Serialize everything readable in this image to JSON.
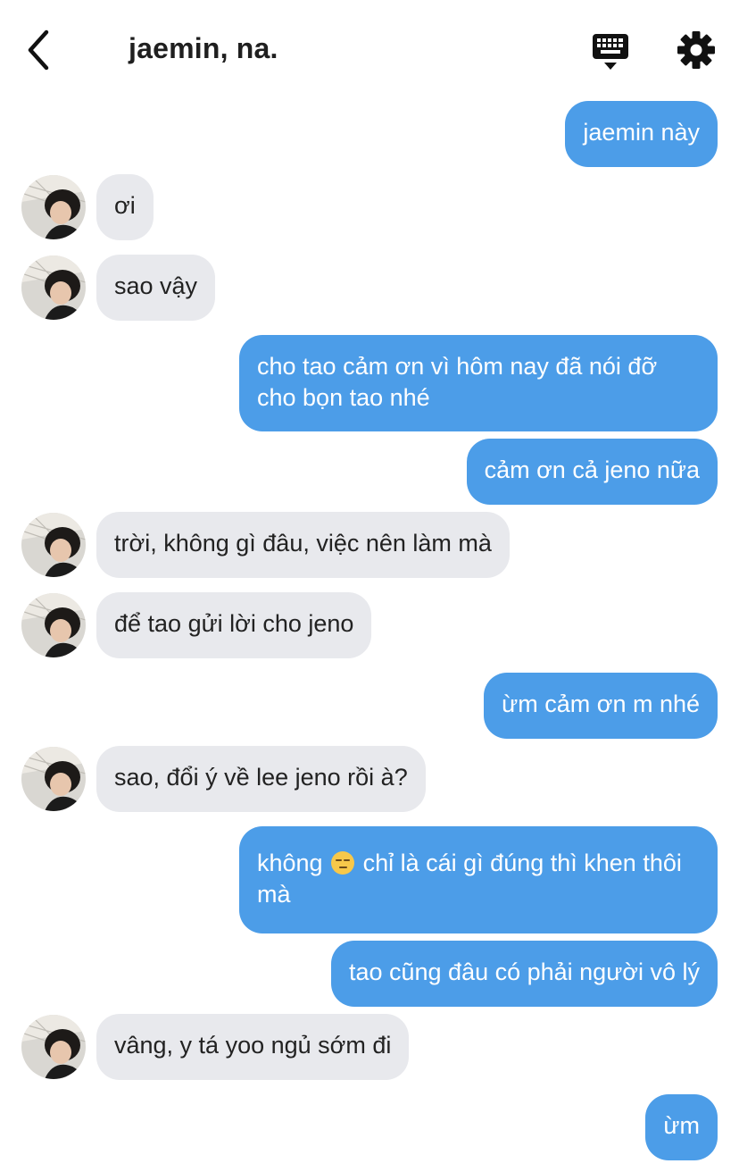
{
  "header": {
    "title": "jaemin, na."
  },
  "icons": {
    "back": "chevron-left-icon",
    "keyboard": "keyboard-icon",
    "settings": "gear-icon"
  },
  "colors": {
    "outgoing_bubble": "#4c9de8",
    "incoming_bubble": "#e8e9ed"
  },
  "messages": [
    {
      "side": "out",
      "text": "jaemin này"
    },
    {
      "side": "in",
      "text": "ơi"
    },
    {
      "side": "in",
      "text": "sao vậy"
    },
    {
      "side": "out",
      "text": "cho tao cảm ơn vì hôm nay đã nói đỡ cho bọn tao nhé"
    },
    {
      "side": "out",
      "text": "cảm ơn cả jeno nữa"
    },
    {
      "side": "in",
      "text": "trời, không gì đâu, việc nên làm mà"
    },
    {
      "side": "in",
      "text": "để tao gửi lời cho jeno"
    },
    {
      "side": "out",
      "text": "ừm cảm ơn m nhé"
    },
    {
      "side": "in",
      "text": "sao, đổi ý về lee jeno rồi à?"
    },
    {
      "side": "out",
      "text_before": "không",
      "emoji": "unamused-face-emoji",
      "text_after": "chỉ là cái gì đúng thì khen thôi mà"
    },
    {
      "side": "out",
      "text": "tao cũng đâu có phải người vô lý"
    },
    {
      "side": "in",
      "text": "vâng, y tá yoo ngủ sớm đi"
    },
    {
      "side": "out",
      "text": "ừm"
    }
  ]
}
